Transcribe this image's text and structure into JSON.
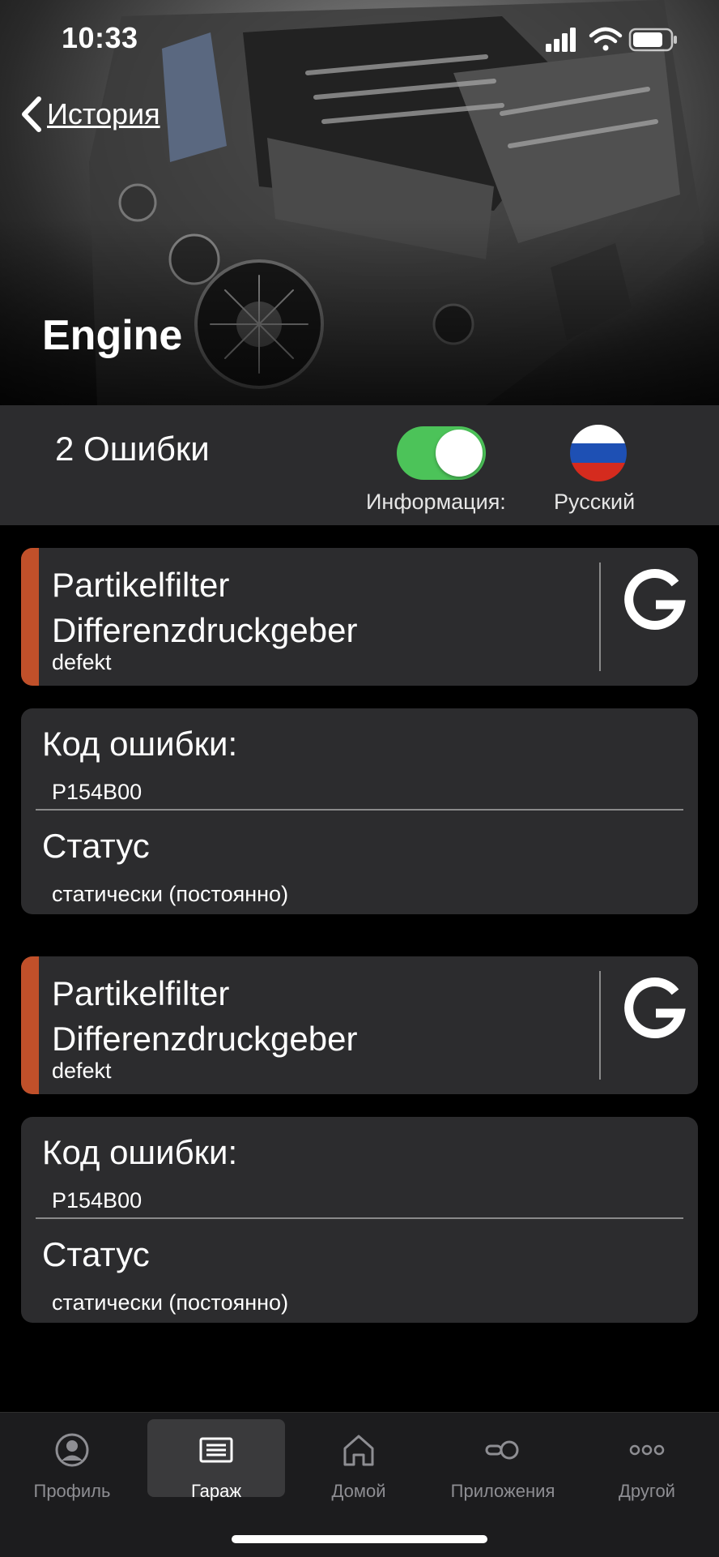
{
  "status_bar": {
    "time": "10:33"
  },
  "nav": {
    "back_label": "История"
  },
  "hero": {
    "title": "Engine"
  },
  "summary": {
    "error_count": "2 Ошибки",
    "toggle_label": "Информация:",
    "toggle_on": true,
    "language": "Русский"
  },
  "faults": [
    {
      "title_line1": "Partikelfilter",
      "title_line2": "Differenzdruckgeber",
      "subtitle": "defekt",
      "code_label": "Код ошибки:",
      "code": "P154B00",
      "status_label": "Статус",
      "status": "статически (постоянно)"
    },
    {
      "title_line1": "Partikelfilter",
      "title_line2": "Differenzdruckgeber",
      "subtitle": "defekt",
      "code_label": "Код ошибки:",
      "code": "P154B00",
      "status_label": "Статус",
      "status": "статически (постоянно)"
    }
  ],
  "tabbar": {
    "items": [
      {
        "label": "Профиль",
        "icon": "profile-icon"
      },
      {
        "label": "Гараж",
        "icon": "garage-icon",
        "active": true
      },
      {
        "label": "Домой",
        "icon": "home-icon"
      },
      {
        "label": "Приложения",
        "icon": "apps-icon"
      },
      {
        "label": "Другой",
        "icon": "more-icon"
      }
    ]
  },
  "colors": {
    "accent_fault": "#c0502a",
    "toggle_on": "#4cc359",
    "card_bg": "#2c2c2e"
  }
}
